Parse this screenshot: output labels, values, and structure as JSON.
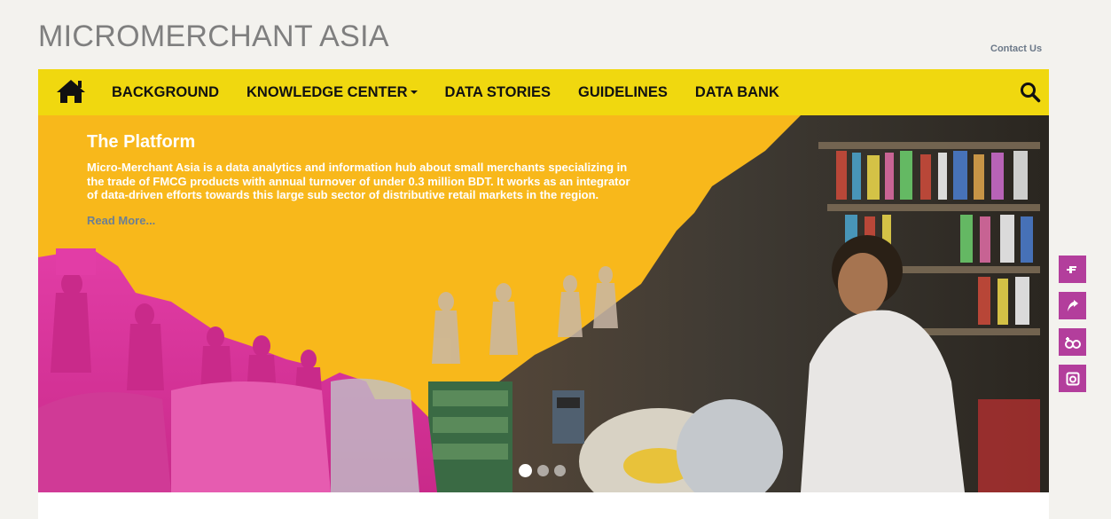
{
  "header": {
    "site_title": "MICROMERCHANT ASIA",
    "contact_label": "Contact Us"
  },
  "nav": {
    "home_icon": "home-icon",
    "items": [
      {
        "label": "BACKGROUND",
        "has_dropdown": false
      },
      {
        "label": "KNOWLEDGE CENTER",
        "has_dropdown": true
      },
      {
        "label": "DATA STORIES",
        "has_dropdown": false
      },
      {
        "label": "GUIDELINES",
        "has_dropdown": false
      },
      {
        "label": "DATA BANK",
        "has_dropdown": false
      }
    ],
    "search_icon": "search-icon",
    "bar_color": "#f0d80f"
  },
  "hero": {
    "title": "The Platform",
    "description": "Micro-Merchant Asia is a data analytics and information hub about small merchants specializing in the trade of FMCG products with annual turnover of under 0.3 million BDT. It works as an integrator of data-driven efforts towards this large sub sector of distributive retail markets in the region.",
    "read_more": "Read More...",
    "slides": 3,
    "active_slide": 1,
    "accent_color": "#f8b81b",
    "magenta": "#e23da6"
  },
  "social": {
    "color": "#b33e9c",
    "icons": [
      "facebook-icon",
      "share-icon",
      "flickr-icon",
      "instagram-icon"
    ]
  }
}
